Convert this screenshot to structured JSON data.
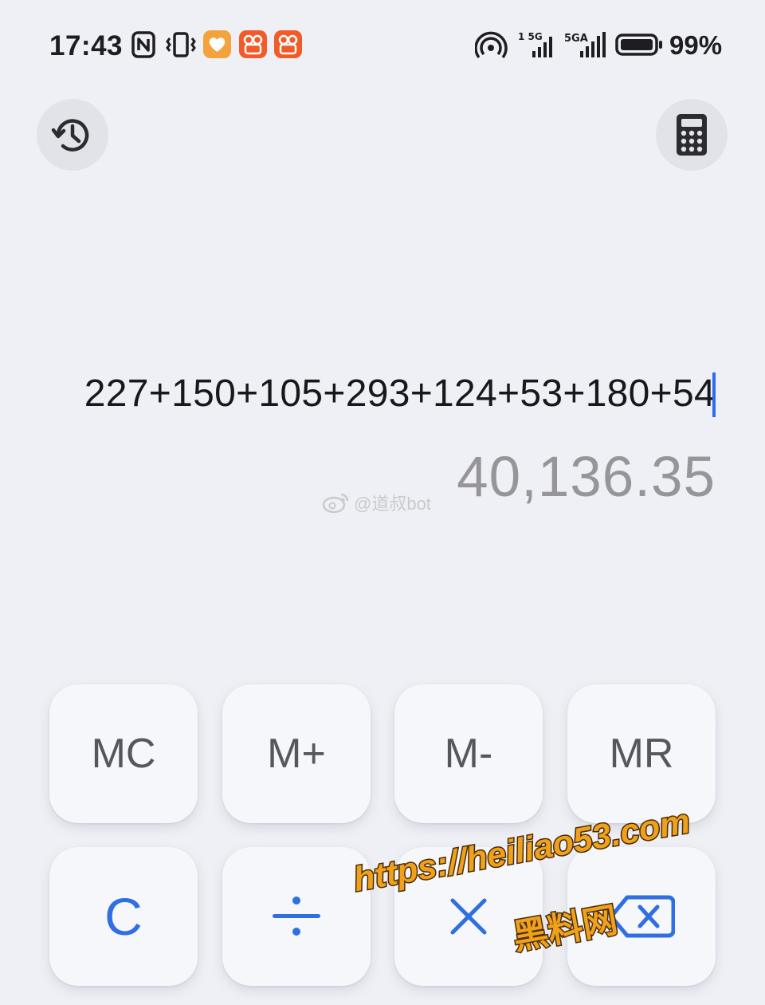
{
  "status_bar": {
    "time": "17:43",
    "signal_1_label": "1 5G",
    "signal_2_label": "5GA",
    "battery": "99%"
  },
  "toolbar": {
    "history_icon": "history-clock-icon",
    "mode_icon": "calculator-icon"
  },
  "display": {
    "expression": "227+150+105+293+124+53+180+54",
    "result": "40,136.35"
  },
  "keypad": {
    "memory_row": [
      "MC",
      "M+",
      "M-",
      "MR"
    ],
    "clear_label": "C",
    "divide_label": "÷",
    "multiply_label": "×",
    "backspace_icon": "backspace-icon"
  },
  "watermarks": {
    "weibo": "@道叔bot",
    "url": "https://heiliao53.com",
    "site_name": "黑料网"
  },
  "colors": {
    "background": "#eff0f5",
    "key_background": "#f6f7fa",
    "operator_blue": "#2f6ee3",
    "result_gray": "#96969a",
    "cursor_blue": "#2c6df0"
  }
}
